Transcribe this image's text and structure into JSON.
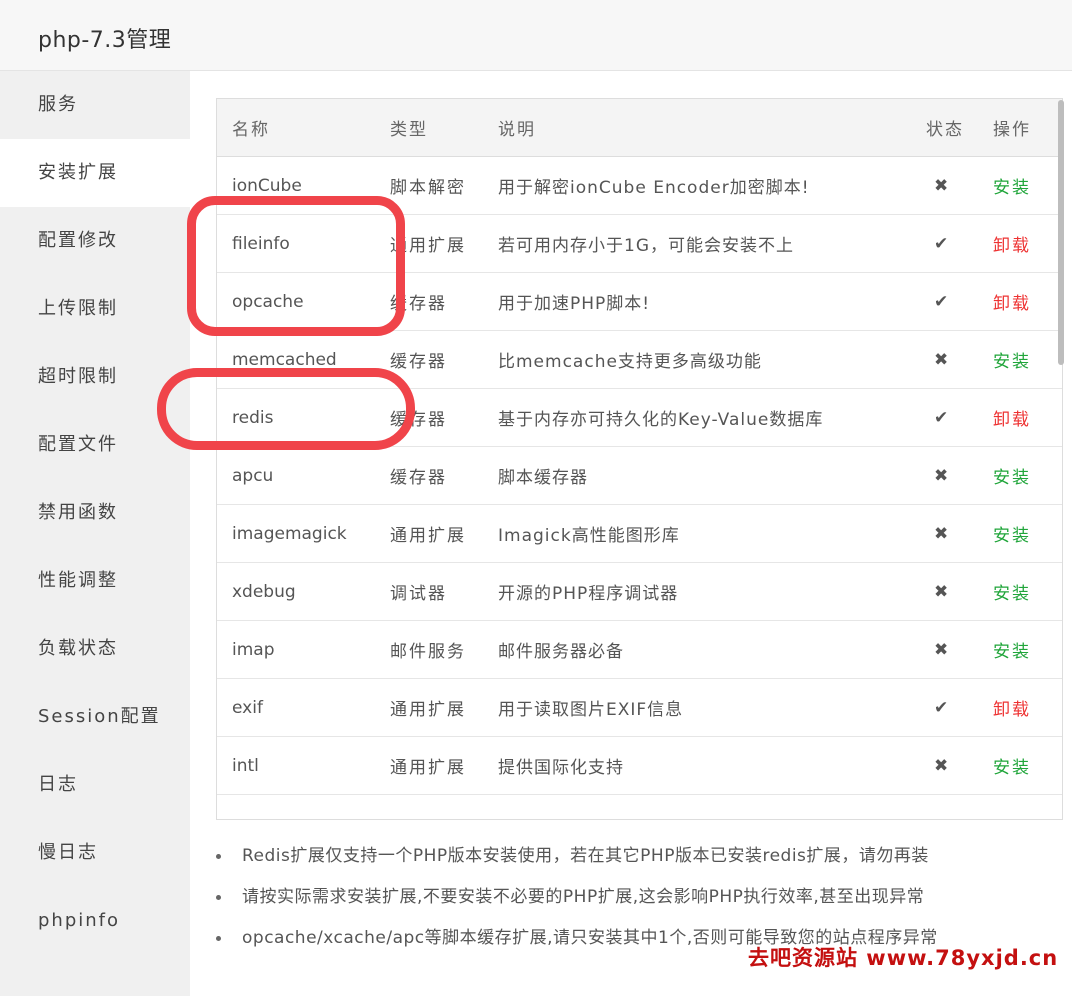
{
  "window": {
    "title": "php-7.3管理"
  },
  "sidebar": {
    "items": [
      {
        "label": "服务"
      },
      {
        "label": "安装扩展",
        "active": true
      },
      {
        "label": "配置修改"
      },
      {
        "label": "上传限制"
      },
      {
        "label": "超时限制"
      },
      {
        "label": "配置文件"
      },
      {
        "label": "禁用函数"
      },
      {
        "label": "性能调整"
      },
      {
        "label": "负载状态"
      },
      {
        "label": "Session配置"
      },
      {
        "label": "日志"
      },
      {
        "label": "慢日志"
      },
      {
        "label": "phpinfo"
      }
    ]
  },
  "table": {
    "headers": {
      "name": "名称",
      "type": "类型",
      "desc": "说明",
      "status": "状态",
      "action": "操作"
    },
    "rows": [
      {
        "name": "ionCube",
        "type": "脚本解密",
        "desc": "用于解密ionCube Encoder加密脚本!",
        "status": "✖",
        "installed": false,
        "action": "安装"
      },
      {
        "name": "fileinfo",
        "type": "通用扩展",
        "desc": "若可用内存小于1G，可能会安装不上",
        "status": "✔",
        "installed": true,
        "action": "卸载"
      },
      {
        "name": "opcache",
        "type": "缓存器",
        "desc": "用于加速PHP脚本!",
        "status": "✔",
        "installed": true,
        "action": "卸载"
      },
      {
        "name": "memcached",
        "type": "缓存器",
        "desc": "比memcache支持更多高级功能",
        "status": "✖",
        "installed": false,
        "action": "安装"
      },
      {
        "name": "redis",
        "type": "缓存器",
        "desc": "基于内存亦可持久化的Key-Value数据库",
        "status": "✔",
        "installed": true,
        "action": "卸载"
      },
      {
        "name": "apcu",
        "type": "缓存器",
        "desc": "脚本缓存器",
        "status": "✖",
        "installed": false,
        "action": "安装"
      },
      {
        "name": "imagemagick",
        "type": "通用扩展",
        "desc": "Imagick高性能图形库",
        "status": "✖",
        "installed": false,
        "action": "安装"
      },
      {
        "name": "xdebug",
        "type": "调试器",
        "desc": "开源的PHP程序调试器",
        "status": "✖",
        "installed": false,
        "action": "安装"
      },
      {
        "name": "imap",
        "type": "邮件服务",
        "desc": "邮件服务器必备",
        "status": "✖",
        "installed": false,
        "action": "安装"
      },
      {
        "name": "exif",
        "type": "通用扩展",
        "desc": "用于读取图片EXIF信息",
        "status": "✔",
        "installed": true,
        "action": "卸载"
      },
      {
        "name": "intl",
        "type": "通用扩展",
        "desc": "提供国际化支持",
        "status": "✖",
        "installed": false,
        "action": "安装"
      }
    ]
  },
  "notes": [
    "Redis扩展仅支持一个PHP版本安装使用，若在其它PHP版本已安装redis扩展，请勿再装",
    "请按实际需求安装扩展,不要安装不必要的PHP扩展,这会影响PHP执行效率,甚至出现异常",
    "opcache/xcache/apc等脚本缓存扩展,请只安装其中1个,否则可能导致您的站点程序异常"
  ],
  "watermark": "去吧资源站 www.78yxjd.cn",
  "colors": {
    "install": "#20a53a",
    "uninstall": "#e33",
    "highlight": "#f0444a",
    "watermark": "#c41010"
  }
}
